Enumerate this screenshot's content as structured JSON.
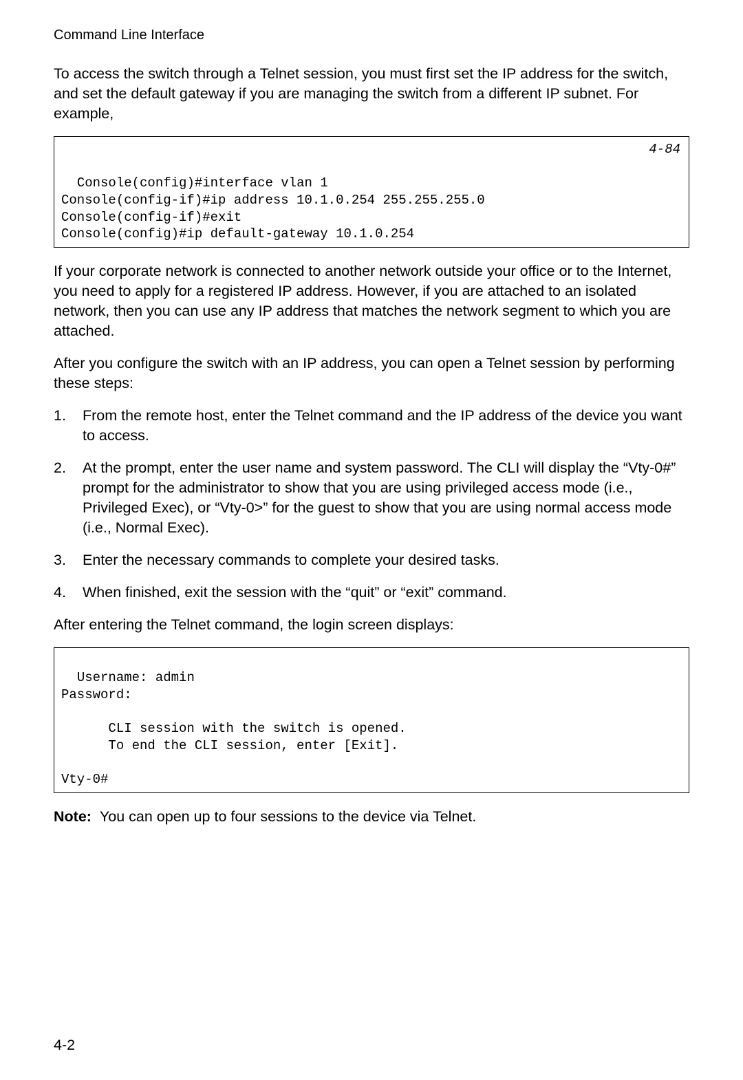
{
  "header": "Command Line Interface",
  "para1": "To access the switch through a Telnet session, you must first set the IP address for the switch, and set the default gateway if you are managing the switch from a different IP subnet. For example,",
  "code1": {
    "ref": "4-84",
    "text": "Console(config)#interface vlan 1\nConsole(config-if)#ip address 10.1.0.254 255.255.255.0\nConsole(config-if)#exit\nConsole(config)#ip default-gateway 10.1.0.254"
  },
  "para2": "If your corporate network is connected to another network outside your office or to the Internet, you need to apply for a registered IP address. However, if you are attached to an isolated network, then you can use any IP address that matches the network segment to which you are attached.",
  "para3": "After you configure the switch with an IP address, you can open a Telnet session by performing these steps:",
  "steps": [
    "From the remote host, enter the Telnet command and the IP address of the device you want to access.",
    "At the prompt, enter the user name and system password. The CLI will display the “Vty-0#” prompt for the administrator to show that you are using privileged access mode (i.e., Privileged Exec), or “Vty-0>” for the guest to show that you are using normal access mode (i.e., Normal Exec).",
    "Enter the necessary commands to complete your desired tasks.",
    "When finished, exit the session with the “quit” or “exit” command."
  ],
  "para4": "After entering the Telnet command, the login screen displays:",
  "code2": {
    "text": "Username: admin\nPassword:\n\n      CLI session with the switch is opened.\n      To end the CLI session, enter [Exit].\n\nVty-0#"
  },
  "note": {
    "label": "Note:",
    "text": "You can open up to four sessions to the device via Telnet."
  },
  "pageNumber": "4-2"
}
